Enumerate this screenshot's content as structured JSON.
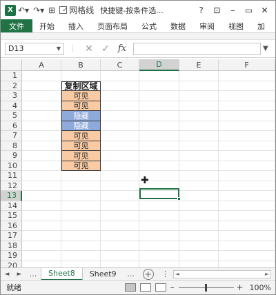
{
  "titlebar": {
    "app_icon": "X",
    "undo_icon": "undo-icon",
    "redo_icon": "redo-icon",
    "gridlines_label": "网格线",
    "gridlines_checked": true,
    "document_title": "快捷键-按条件选...",
    "help": "?",
    "minimize": "–",
    "restore": "▭",
    "close": "✕"
  },
  "ribbon": {
    "tabs": [
      "文件",
      "开始",
      "插入",
      "页面布局",
      "公式",
      "数据",
      "审阅",
      "视图",
      "加"
    ],
    "accent": "#217346"
  },
  "formula_bar": {
    "name_box": "D13",
    "cancel_icon": "✕",
    "enter_icon": "✓",
    "fx": "fx",
    "value": ""
  },
  "grid": {
    "columns": [
      "A",
      "B",
      "C",
      "D",
      "E",
      "F"
    ],
    "selected_column": "D",
    "rows": [
      "1",
      "2",
      "3",
      "4",
      "5",
      "6",
      "7",
      "8",
      "9",
      "10",
      "11",
      "12",
      "13",
      "14",
      "15",
      "16",
      "17",
      "18",
      "19",
      "20"
    ],
    "selected_row": "13",
    "active_cell": "D13",
    "table": {
      "header": "复制区域",
      "cells": [
        {
          "text": "可见",
          "kind": "visible"
        },
        {
          "text": "可见",
          "kind": "visible"
        },
        {
          "text": "隐藏",
          "kind": "hidden"
        },
        {
          "text": "隐藏",
          "kind": "hidden"
        },
        {
          "text": "可见",
          "kind": "visible"
        },
        {
          "text": "可见",
          "kind": "visible"
        },
        {
          "text": "可见",
          "kind": "visible"
        },
        {
          "text": "可见",
          "kind": "visible"
        }
      ],
      "visible_color": "#f8cba5",
      "hidden_color": "#8eaadb"
    }
  },
  "sheets": {
    "prev_icon": "◄",
    "next_icon": "►",
    "ellipsis": "...",
    "tabs": [
      "Sheet8",
      "Sheet9"
    ],
    "active": "Sheet8",
    "trailing_ellipsis": "...",
    "add_icon": "+"
  },
  "statusbar": {
    "status": "就绪",
    "zoom_minus": "–",
    "zoom_plus": "+",
    "zoom_level": "100%",
    "zoom_fraction": 0.5
  }
}
